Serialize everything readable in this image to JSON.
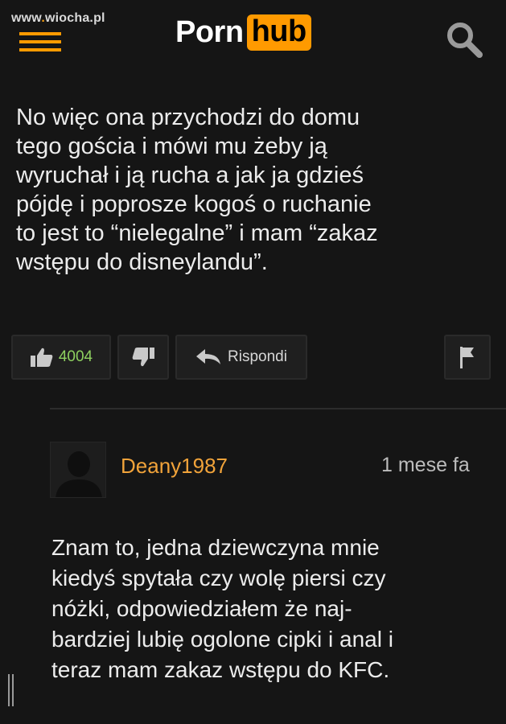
{
  "watermark": {
    "prefix": "www",
    "dot": ".",
    "domain": "wiocha.pl"
  },
  "header": {
    "logo_left": "Porn",
    "logo_right": "hub",
    "accent_color": "#ff9a00",
    "menu_icon": "hamburger-menu-icon",
    "search_icon": "search-icon"
  },
  "comment": {
    "lines": [
      "No więc ona przychodzi do domu",
      "tego gościa i mówi mu żeby ją",
      "wyruchał i ją rucha a jak ja gdzieś",
      "pójdę i poprosze kogoś o ruchanie",
      "to jest to “nielegalne” i mam “zakaz",
      "wstępu do disneylandu”."
    ],
    "actions": {
      "like_count": "4004",
      "reply_label": "Rispondi",
      "like_icon": "thumbs-up-icon",
      "dislike_icon": "thumbs-down-icon",
      "reply_icon": "reply-arrow-icon",
      "flag_icon": "flag-icon"
    }
  },
  "reply": {
    "username": "Deany1987",
    "timestamp": "1 mese fa",
    "username_color": "#f1a33a",
    "lines": [
      "Znam to, jedna dziewczyna mnie",
      "kiedyś spytała czy wolę piersi czy",
      "nóżki, odpowiedziałem że naj-",
      "bardziej lubię ogolone cipki i anal i",
      "teraz mam zakaz wstępu do KFC."
    ]
  }
}
